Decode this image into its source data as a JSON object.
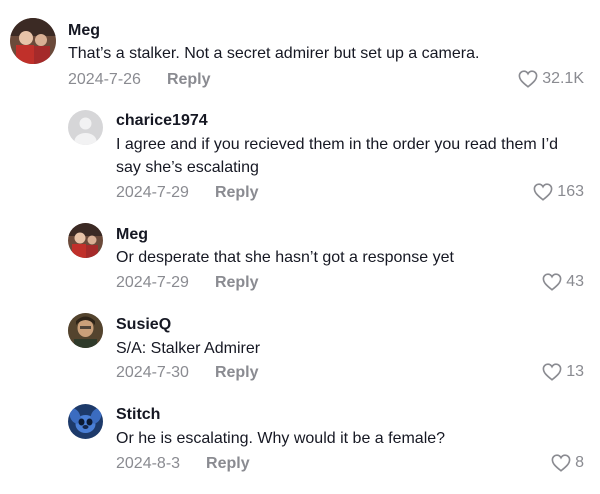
{
  "comments": [
    {
      "user": "Meg",
      "text": "That’s a stalker. Not a secret admirer but set up a camera.",
      "date": "2024-7-26",
      "reply": "Reply",
      "likes": "32.1K",
      "avatar": "meg-avatar"
    },
    {
      "user": "charice1974",
      "text": "I agree and if you recieved them in the order you read them I’d say she’s escalating",
      "date": "2024-7-29",
      "reply": "Reply",
      "likes": "163",
      "avatar": "default-avatar"
    },
    {
      "user": "Meg",
      "text": "Or desperate that she hasn’t got a response yet",
      "date": "2024-7-29",
      "reply": "Reply",
      "likes": "43",
      "avatar": "meg-avatar"
    },
    {
      "user": "SusieQ",
      "text": "S/A: Stalker Admirer",
      "date": "2024-7-30",
      "reply": "Reply",
      "likes": "13",
      "avatar": "susieq-avatar"
    },
    {
      "user": "Stitch",
      "text": "Or he is escalating. Why would it be a female?",
      "date": "2024-8-3",
      "reply": "Reply",
      "likes": "8",
      "avatar": "stitch-avatar"
    }
  ],
  "colors": {
    "text": "#161823",
    "muted": "#8a8b91",
    "background": "#ffffff"
  }
}
